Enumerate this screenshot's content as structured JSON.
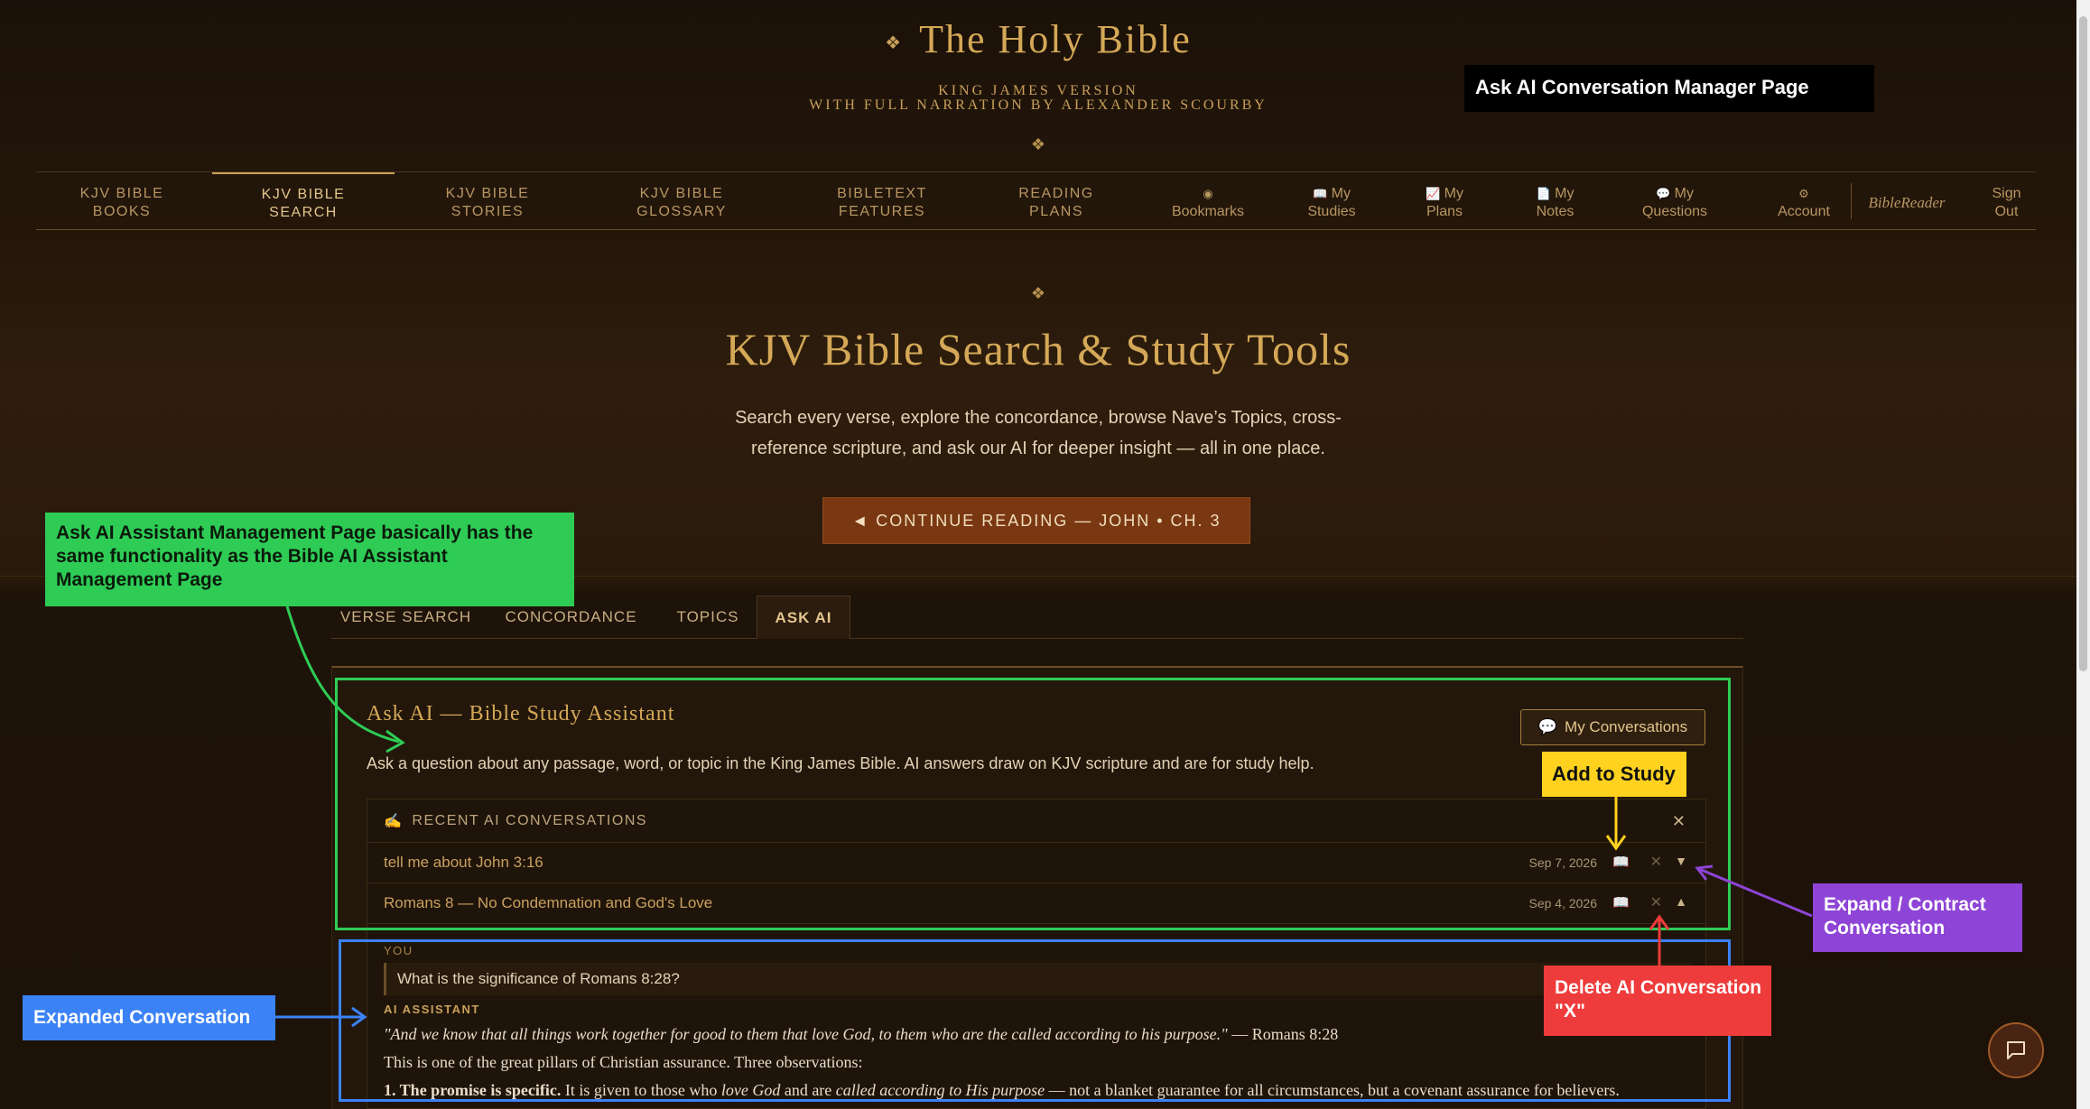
{
  "header": {
    "title": "The Holy Bible",
    "title_ornament": "❖",
    "subtitle_line1": "KING JAMES VERSION",
    "subtitle_line2": "WITH FULL NARRATION BY ALEXANDER SCOURBY",
    "ornament": "❖"
  },
  "nav": {
    "books_1": "KJV BIBLE",
    "books_2": "BOOKS",
    "search_1": "KJV BIBLE",
    "search_2": "SEARCH",
    "stories_1": "KJV BIBLE",
    "stories_2": "STORIES",
    "glossary_1": "KJV BIBLE",
    "glossary_2": "GLOSSARY",
    "features_1": "BIBLETEXT",
    "features_2": "FEATURES",
    "plans_1": "READING",
    "plans_2": "PLANS",
    "bookmarks_icon": "◉",
    "bookmarks": "Bookmarks",
    "studies_icon": "📖",
    "studies_1": "My",
    "studies_2": "Studies",
    "myplans_icon": "📈",
    "myplans_1": "My",
    "myplans_2": "Plans",
    "notes_icon": "📄",
    "notes_1": "My",
    "notes_2": "Notes",
    "questions_icon": "💬",
    "questions_1": "My",
    "questions_2": "Questions",
    "account_icon": "⚙",
    "account": "Account",
    "user": "BibleReader",
    "signout_1": "Sign",
    "signout_2": "Out"
  },
  "hero": {
    "ornament": "❖",
    "title": "KJV Bible Search & Study Tools",
    "desc_line1": "Search every verse, explore the concordance, browse Nave’s Topics, cross-",
    "desc_line2": "reference scripture, and ask our AI for deeper insight — all in one place.",
    "continue_label": "◄ CONTINUE READING — JOHN • CH. 3"
  },
  "tabs": [
    "VERSE SEARCH",
    "CONCORDANCE",
    "TOPICS",
    "ASK AI"
  ],
  "ask_ai": {
    "title": "Ask AI — Bible Study Assistant",
    "my_conversations_icon": "💬",
    "my_conversations": "My Conversations",
    "description": "Ask a question about any passage, word, or topic in the King James Bible. AI answers draw on KJV scripture and are for study help.",
    "recent_icon": "✍",
    "recent_header": "RECENT AI CONVERSATIONS",
    "close": "✕",
    "conversations": [
      {
        "title": "tell me about John 3:16",
        "date": "Sep 7, 2026",
        "toggle": "▼"
      },
      {
        "title": "Romans 8 — No Condemnation and God's Love",
        "date": "Sep 4, 2026",
        "toggle": "▲"
      }
    ],
    "book_icon": "📖",
    "delete_icon": "✕",
    "expanded": {
      "you_label": "YOU",
      "question": "What is the significance of Romans 8:28?",
      "ai_label": "AI ASSISTANT",
      "quote": "\"And we know that all things work together for good to them that love God, to them who are the called according to his purpose.\"",
      "quote_ref": " — Romans 8:28",
      "intro": "This is one of the great pillars of Christian assurance. Three observations:",
      "point1_bold": "1. The promise is specific.",
      "point1_a": " It is given to those who ",
      "point1_i1": "love God",
      "point1_b": " and are ",
      "point1_i2": "called according to His purpose",
      "point1_c": " — not a blanket guarantee for all circumstances, but a covenant assurance for believers."
    }
  },
  "annotations": {
    "page_label": "Ask AI Conversation Manager Page",
    "green_note": "Ask AI Assistant Management Page basically has the same functionality as the Bible AI Assistant Management Page",
    "add_to_study": "Add to Study",
    "expand_contract": "Expand / Contract Conversation",
    "delete_note": "Delete AI Conversation \"X\"",
    "expanded_note": "Expanded Conversation",
    "colors": {
      "green": "#2ecc55",
      "blue": "#3b82f6",
      "yellow": "#ffd21f",
      "purple": "#8e44d6",
      "red": "#ee3b3b"
    }
  }
}
